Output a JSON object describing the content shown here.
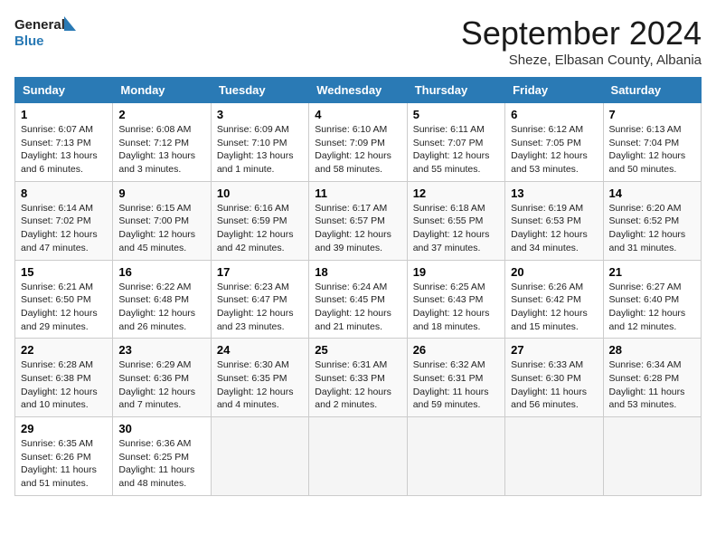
{
  "header": {
    "logo_text_general": "General",
    "logo_text_blue": "Blue",
    "month_title": "September 2024",
    "subtitle": "Sheze, Elbasan County, Albania"
  },
  "weekdays": [
    "Sunday",
    "Monday",
    "Tuesday",
    "Wednesday",
    "Thursday",
    "Friday",
    "Saturday"
  ],
  "weeks": [
    [
      {
        "day": "1",
        "info": "Sunrise: 6:07 AM\nSunset: 7:13 PM\nDaylight: 13 hours\nand 6 minutes."
      },
      {
        "day": "2",
        "info": "Sunrise: 6:08 AM\nSunset: 7:12 PM\nDaylight: 13 hours\nand 3 minutes."
      },
      {
        "day": "3",
        "info": "Sunrise: 6:09 AM\nSunset: 7:10 PM\nDaylight: 13 hours\nand 1 minute."
      },
      {
        "day": "4",
        "info": "Sunrise: 6:10 AM\nSunset: 7:09 PM\nDaylight: 12 hours\nand 58 minutes."
      },
      {
        "day": "5",
        "info": "Sunrise: 6:11 AM\nSunset: 7:07 PM\nDaylight: 12 hours\nand 55 minutes."
      },
      {
        "day": "6",
        "info": "Sunrise: 6:12 AM\nSunset: 7:05 PM\nDaylight: 12 hours\nand 53 minutes."
      },
      {
        "day": "7",
        "info": "Sunrise: 6:13 AM\nSunset: 7:04 PM\nDaylight: 12 hours\nand 50 minutes."
      }
    ],
    [
      {
        "day": "8",
        "info": "Sunrise: 6:14 AM\nSunset: 7:02 PM\nDaylight: 12 hours\nand 47 minutes."
      },
      {
        "day": "9",
        "info": "Sunrise: 6:15 AM\nSunset: 7:00 PM\nDaylight: 12 hours\nand 45 minutes."
      },
      {
        "day": "10",
        "info": "Sunrise: 6:16 AM\nSunset: 6:59 PM\nDaylight: 12 hours\nand 42 minutes."
      },
      {
        "day": "11",
        "info": "Sunrise: 6:17 AM\nSunset: 6:57 PM\nDaylight: 12 hours\nand 39 minutes."
      },
      {
        "day": "12",
        "info": "Sunrise: 6:18 AM\nSunset: 6:55 PM\nDaylight: 12 hours\nand 37 minutes."
      },
      {
        "day": "13",
        "info": "Sunrise: 6:19 AM\nSunset: 6:53 PM\nDaylight: 12 hours\nand 34 minutes."
      },
      {
        "day": "14",
        "info": "Sunrise: 6:20 AM\nSunset: 6:52 PM\nDaylight: 12 hours\nand 31 minutes."
      }
    ],
    [
      {
        "day": "15",
        "info": "Sunrise: 6:21 AM\nSunset: 6:50 PM\nDaylight: 12 hours\nand 29 minutes."
      },
      {
        "day": "16",
        "info": "Sunrise: 6:22 AM\nSunset: 6:48 PM\nDaylight: 12 hours\nand 26 minutes."
      },
      {
        "day": "17",
        "info": "Sunrise: 6:23 AM\nSunset: 6:47 PM\nDaylight: 12 hours\nand 23 minutes."
      },
      {
        "day": "18",
        "info": "Sunrise: 6:24 AM\nSunset: 6:45 PM\nDaylight: 12 hours\nand 21 minutes."
      },
      {
        "day": "19",
        "info": "Sunrise: 6:25 AM\nSunset: 6:43 PM\nDaylight: 12 hours\nand 18 minutes."
      },
      {
        "day": "20",
        "info": "Sunrise: 6:26 AM\nSunset: 6:42 PM\nDaylight: 12 hours\nand 15 minutes."
      },
      {
        "day": "21",
        "info": "Sunrise: 6:27 AM\nSunset: 6:40 PM\nDaylight: 12 hours\nand 12 minutes."
      }
    ],
    [
      {
        "day": "22",
        "info": "Sunrise: 6:28 AM\nSunset: 6:38 PM\nDaylight: 12 hours\nand 10 minutes."
      },
      {
        "day": "23",
        "info": "Sunrise: 6:29 AM\nSunset: 6:36 PM\nDaylight: 12 hours\nand 7 minutes."
      },
      {
        "day": "24",
        "info": "Sunrise: 6:30 AM\nSunset: 6:35 PM\nDaylight: 12 hours\nand 4 minutes."
      },
      {
        "day": "25",
        "info": "Sunrise: 6:31 AM\nSunset: 6:33 PM\nDaylight: 12 hours\nand 2 minutes."
      },
      {
        "day": "26",
        "info": "Sunrise: 6:32 AM\nSunset: 6:31 PM\nDaylight: 11 hours\nand 59 minutes."
      },
      {
        "day": "27",
        "info": "Sunrise: 6:33 AM\nSunset: 6:30 PM\nDaylight: 11 hours\nand 56 minutes."
      },
      {
        "day": "28",
        "info": "Sunrise: 6:34 AM\nSunset: 6:28 PM\nDaylight: 11 hours\nand 53 minutes."
      }
    ],
    [
      {
        "day": "29",
        "info": "Sunrise: 6:35 AM\nSunset: 6:26 PM\nDaylight: 11 hours\nand 51 minutes."
      },
      {
        "day": "30",
        "info": "Sunrise: 6:36 AM\nSunset: 6:25 PM\nDaylight: 11 hours\nand 48 minutes."
      },
      {
        "day": "",
        "info": ""
      },
      {
        "day": "",
        "info": ""
      },
      {
        "day": "",
        "info": ""
      },
      {
        "day": "",
        "info": ""
      },
      {
        "day": "",
        "info": ""
      }
    ]
  ]
}
